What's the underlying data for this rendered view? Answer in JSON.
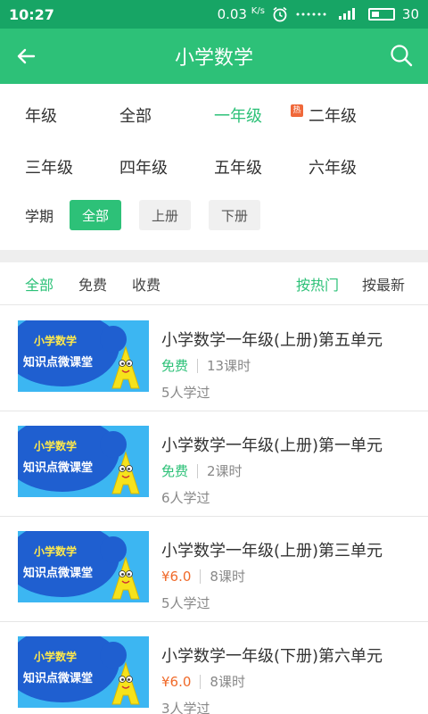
{
  "status_bar": {
    "time": "10:27",
    "speed": "0.03",
    "speed_unit": "K/s",
    "battery": "30"
  },
  "header": {
    "title": "小学数学"
  },
  "grade_filter": {
    "label": "年级",
    "options": [
      "全部",
      "一年级",
      "二年级",
      "三年级",
      "四年级",
      "五年级",
      "六年级"
    ],
    "selected": "一年级",
    "badge": "热"
  },
  "term_filter": {
    "label": "学期",
    "options": [
      "全部",
      "上册",
      "下册"
    ],
    "selected": "全部"
  },
  "sort_bar": {
    "tabs": [
      "全部",
      "免费",
      "收费"
    ],
    "selected_tab": "全部",
    "orders": [
      "按热门",
      "按最新"
    ],
    "selected_order": "按热门"
  },
  "thumbnail_text": {
    "line1": "小学数学",
    "line2": "知识点微课堂"
  },
  "courses": [
    {
      "title": "小学数学一年级(上册)第五单元",
      "price": "免费",
      "price_type": "free",
      "lessons": "13课时",
      "learners": "5人学过"
    },
    {
      "title": "小学数学一年级(上册)第一单元",
      "price": "免费",
      "price_type": "free",
      "lessons": "2课时",
      "learners": "6人学过"
    },
    {
      "title": "小学数学一年级(上册)第三单元",
      "price": "¥6.0",
      "price_type": "paid",
      "lessons": "8课时",
      "learners": "5人学过"
    },
    {
      "title": "小学数学一年级(下册)第六单元",
      "price": "¥6.0",
      "price_type": "paid",
      "lessons": "8课时",
      "learners": "3人学过"
    }
  ],
  "colors": {
    "primary": "#2dc178",
    "status_bar": "#17a565",
    "paid_price": "#f06a2a",
    "badge": "#f0683a"
  }
}
